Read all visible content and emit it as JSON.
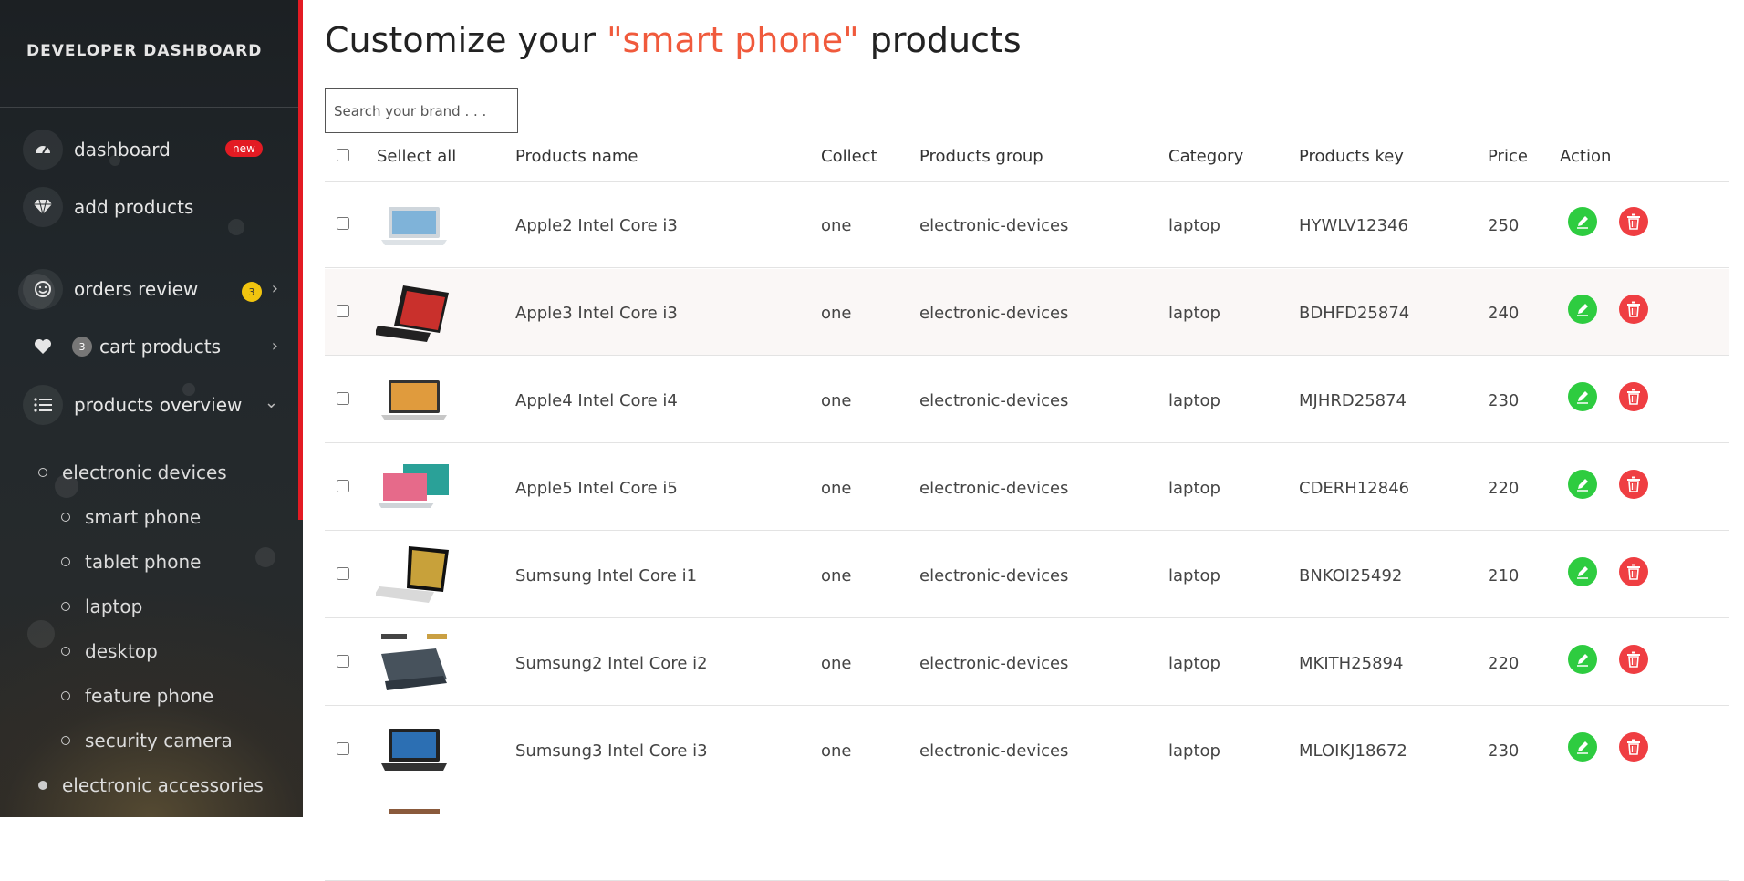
{
  "sidebar": {
    "brand": "DEVELOPER DASHBOARD",
    "items": [
      {
        "label": "dashboard",
        "icon": "speedometer-icon",
        "badge": "new"
      },
      {
        "label": "add products",
        "icon": "diamond-icon"
      },
      {
        "label": "orders review",
        "icon": "smiley-icon",
        "badge": "3"
      },
      {
        "label": "cart products",
        "icon": "heart-icon",
        "badge": "3"
      },
      {
        "label": "products overview",
        "icon": "list-icon"
      }
    ],
    "sub_items": [
      {
        "label": "electronic devices"
      },
      {
        "label": "smart phone"
      },
      {
        "label": "tablet phone"
      },
      {
        "label": "laptop"
      },
      {
        "label": "desktop"
      },
      {
        "label": "feature phone"
      },
      {
        "label": "security camera"
      },
      {
        "label": "electronic accessories"
      }
    ],
    "colors": {
      "accent_red": "#e31b23",
      "badge_yellow": "#f1c40f"
    }
  },
  "main": {
    "title_prefix": "Customize your ",
    "title_accent": "\"smart phone\"",
    "title_suffix": " products",
    "accent_color": "#f05a3c",
    "search_placeholder": "Search your brand . . .",
    "columns": [
      "Sellect all",
      "Products name",
      "Collect",
      "Products group",
      "Category",
      "Products key",
      "Price",
      "Action"
    ],
    "rows": [
      {
        "name": "Apple2 Intel Core i3",
        "collect": "one",
        "group": "electronic-devices",
        "category": "laptop",
        "key": "HYWLV12346",
        "price": "250"
      },
      {
        "name": "Apple3 Intel Core i3",
        "collect": "one",
        "group": "electronic-devices",
        "category": "laptop",
        "key": "BDHFD25874",
        "price": "240"
      },
      {
        "name": "Apple4 Intel Core i4",
        "collect": "one",
        "group": "electronic-devices",
        "category": "laptop",
        "key": "MJHRD25874",
        "price": "230"
      },
      {
        "name": "Apple5 Intel Core i5",
        "collect": "one",
        "group": "electronic-devices",
        "category": "laptop",
        "key": "CDERH12846",
        "price": "220"
      },
      {
        "name": "Sumsung Intel Core i1",
        "collect": "one",
        "group": "electronic-devices",
        "category": "laptop",
        "key": "BNKOI25492",
        "price": "210"
      },
      {
        "name": "Sumsung2 Intel Core i2",
        "collect": "one",
        "group": "electronic-devices",
        "category": "laptop",
        "key": "MKITH25894",
        "price": "220"
      },
      {
        "name": "Sumsung3 Intel Core i3",
        "collect": "one",
        "group": "electronic-devices",
        "category": "laptop",
        "key": "MLOIKJ18672",
        "price": "230"
      }
    ],
    "action_colors": {
      "edit": "#2ecc40",
      "delete": "#ef3e42"
    }
  }
}
